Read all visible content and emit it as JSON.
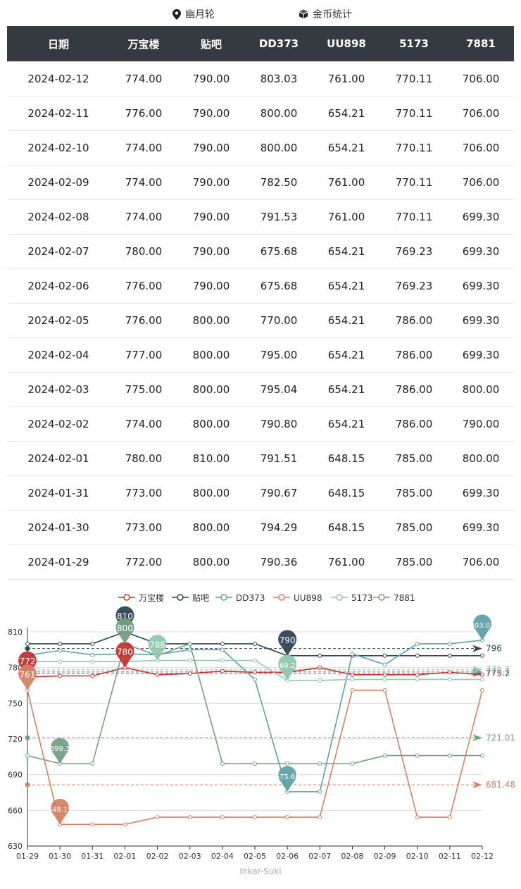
{
  "header": {
    "server_label": "幽月轮",
    "stats_label": "金币统计",
    "server_icon": "map-pin-icon",
    "stats_icon": "cube-icon"
  },
  "table": {
    "columns": [
      "日期",
      "万宝楼",
      "贴吧",
      "DD373",
      "UU898",
      "5173",
      "7881"
    ],
    "rows": [
      [
        "2024-02-12",
        "774.00",
        "790.00",
        "803.03",
        "761.00",
        "770.11",
        "706.00"
      ],
      [
        "2024-02-11",
        "776.00",
        "790.00",
        "800.00",
        "654.21",
        "770.11",
        "706.00"
      ],
      [
        "2024-02-10",
        "774.00",
        "790.00",
        "800.00",
        "654.21",
        "770.11",
        "706.00"
      ],
      [
        "2024-02-09",
        "774.00",
        "790.00",
        "782.50",
        "761.00",
        "770.11",
        "706.00"
      ],
      [
        "2024-02-08",
        "774.00",
        "790.00",
        "791.53",
        "761.00",
        "770.11",
        "699.30"
      ],
      [
        "2024-02-07",
        "780.00",
        "790.00",
        "675.68",
        "654.21",
        "769.23",
        "699.30"
      ],
      [
        "2024-02-06",
        "776.00",
        "790.00",
        "675.68",
        "654.21",
        "769.23",
        "699.30"
      ],
      [
        "2024-02-05",
        "776.00",
        "800.00",
        "770.00",
        "654.21",
        "786.00",
        "699.30"
      ],
      [
        "2024-02-04",
        "777.00",
        "800.00",
        "795.00",
        "654.21",
        "786.00",
        "699.30"
      ],
      [
        "2024-02-03",
        "775.00",
        "800.00",
        "795.04",
        "654.21",
        "786.00",
        "800.00"
      ],
      [
        "2024-02-02",
        "774.00",
        "800.00",
        "790.80",
        "654.21",
        "786.00",
        "790.00"
      ],
      [
        "2024-02-01",
        "780.00",
        "810.00",
        "791.51",
        "648.15",
        "785.00",
        "800.00"
      ],
      [
        "2024-01-31",
        "773.00",
        "800.00",
        "790.67",
        "648.15",
        "785.00",
        "699.30"
      ],
      [
        "2024-01-30",
        "773.00",
        "800.00",
        "794.29",
        "648.15",
        "785.00",
        "699.30"
      ],
      [
        "2024-01-29",
        "772.00",
        "800.00",
        "790.36",
        "761.00",
        "785.00",
        "706.00"
      ]
    ]
  },
  "chart_data": {
    "type": "line",
    "categories": [
      "01-29",
      "01-30",
      "01-31",
      "02-01",
      "02-02",
      "02-03",
      "02-04",
      "02-05",
      "02-06",
      "02-07",
      "02-08",
      "02-09",
      "02-10",
      "02-11",
      "02-12"
    ],
    "ylim": [
      630,
      810
    ],
    "yticks": [
      "630",
      "660",
      "690",
      "720",
      "750",
      "780",
      "810"
    ],
    "grid": true,
    "legend_position": "top-center",
    "series": [
      {
        "name": "万宝楼",
        "color": "#c23531",
        "values": [
          772,
          773,
          773,
          780,
          774,
          775,
          777,
          776,
          776,
          780,
          774,
          774,
          774,
          776,
          774
        ],
        "max_pin": {
          "index": 3,
          "label": "780"
        },
        "min_pin": {
          "index": 0,
          "label": "772"
        },
        "avg_label": "775.2"
      },
      {
        "name": "贴吧",
        "color": "#2f4554",
        "values": [
          800,
          800,
          800,
          810,
          800,
          800,
          800,
          800,
          790,
          790,
          790,
          790,
          790,
          790,
          790
        ],
        "max_pin": {
          "index": 3,
          "label": "810"
        },
        "min_pin": {
          "index": 8,
          "label": "790"
        },
        "avg_label": "796"
      },
      {
        "name": "DD373",
        "color": "#61a0a8",
        "values": [
          790.36,
          794.29,
          790.67,
          791.51,
          790.8,
          795.04,
          795,
          770,
          675.68,
          675.68,
          791.53,
          782.5,
          800,
          800,
          803.03
        ],
        "max_pin": {
          "index": 14,
          "label": "803.03"
        },
        "min_pin": {
          "index": 8,
          "label": "675.68"
        },
        "avg_label": "776.1"
      },
      {
        "name": "UU898",
        "color": "#d48265",
        "values": [
          761,
          648.15,
          648.15,
          648.15,
          654.21,
          654.21,
          654.21,
          654.21,
          654.21,
          654.21,
          761,
          761,
          654.21,
          654.21,
          761
        ],
        "max_pin": {
          "index": 0,
          "label": "761"
        },
        "min_pin": {
          "index": 1,
          "label": "648.15"
        },
        "avg_label": "681.48"
      },
      {
        "name": "5173",
        "color": "#91c7ae",
        "values": [
          785,
          785,
          785,
          785,
          786,
          786,
          786,
          786,
          769.23,
          769.23,
          770.11,
          770.11,
          770.11,
          770.11,
          770.11
        ],
        "max_pin": {
          "index": 4,
          "label": "786"
        },
        "min_pin": {
          "index": 8,
          "label": "769.23"
        },
        "avg_label": "778.3"
      },
      {
        "name": "7881",
        "color": "#749f83",
        "values": [
          706,
          699.3,
          699.3,
          800,
          790,
          800,
          699.3,
          699.3,
          699.3,
          699.3,
          699.3,
          706,
          706,
          706,
          706
        ],
        "max_pin": {
          "index": 3,
          "label": "800"
        },
        "min_pin": {
          "index": 1,
          "label": "699.3"
        },
        "avg_label": "721.01"
      }
    ]
  },
  "footer": {
    "watermark": "Inkar-Suki"
  }
}
